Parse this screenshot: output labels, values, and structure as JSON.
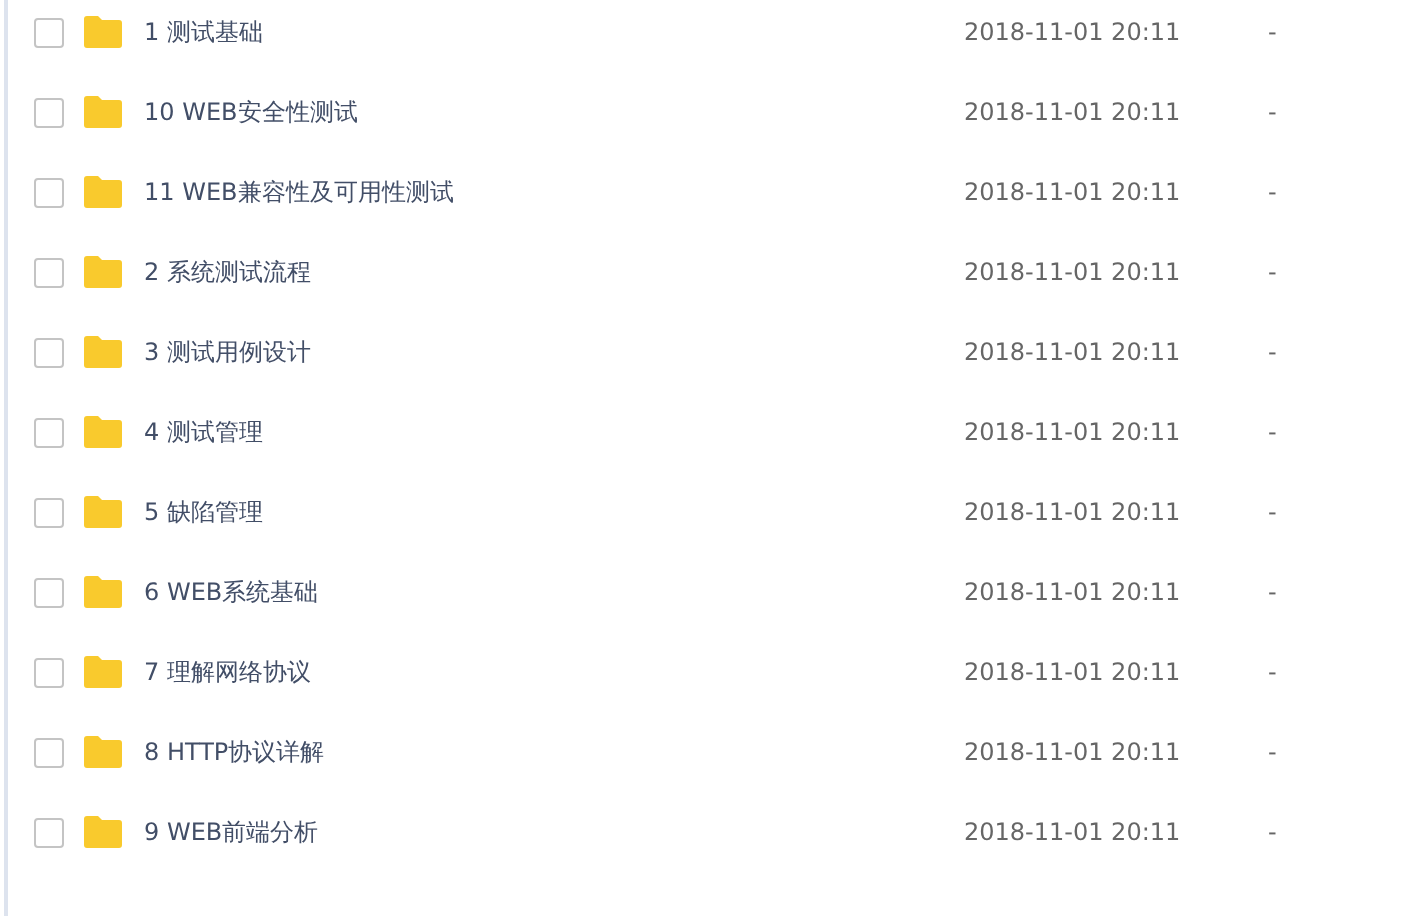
{
  "files": [
    {
      "name": "1 测试基础",
      "modified": "2018-11-01 20:11",
      "size": "-",
      "checked": false
    },
    {
      "name": "10 WEB安全性测试",
      "modified": "2018-11-01 20:11",
      "size": "-",
      "checked": false
    },
    {
      "name": "11 WEB兼容性及可用性测试",
      "modified": "2018-11-01 20:11",
      "size": "-",
      "checked": false
    },
    {
      "name": "2 系统测试流程",
      "modified": "2018-11-01 20:11",
      "size": "-",
      "checked": false
    },
    {
      "name": "3 测试用例设计",
      "modified": "2018-11-01 20:11",
      "size": "-",
      "checked": false
    },
    {
      "name": "4 测试管理",
      "modified": "2018-11-01 20:11",
      "size": "-",
      "checked": false
    },
    {
      "name": "5 缺陷管理",
      "modified": "2018-11-01 20:11",
      "size": "-",
      "checked": false
    },
    {
      "name": "6 WEB系统基础",
      "modified": "2018-11-01 20:11",
      "size": "-",
      "checked": false
    },
    {
      "name": "7 理解网络协议",
      "modified": "2018-11-01 20:11",
      "size": "-",
      "checked": false
    },
    {
      "name": "8 HTTP协议详解",
      "modified": "2018-11-01 20:11",
      "size": "-",
      "checked": false
    },
    {
      "name": "9 WEB前端分析",
      "modified": "2018-11-01 20:11",
      "size": "-",
      "checked": false
    }
  ]
}
